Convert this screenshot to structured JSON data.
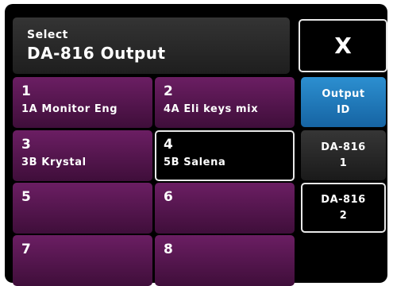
{
  "header": {
    "small_title": "Select",
    "big_title": "DA-816 Output",
    "close_label": "X"
  },
  "tiles": [
    {
      "number": "1",
      "label": "1A Monitor Eng",
      "selected": false
    },
    {
      "number": "2",
      "label": "4A Eli keys mix",
      "selected": false
    },
    {
      "number": "3",
      "label": "3B Krystal",
      "selected": false
    },
    {
      "number": "4",
      "label": "5B Salena",
      "selected": true
    },
    {
      "number": "5",
      "label": "",
      "selected": false
    },
    {
      "number": "6",
      "label": "",
      "selected": false
    },
    {
      "number": "7",
      "label": "",
      "selected": false
    },
    {
      "number": "8",
      "label": "",
      "selected": false
    }
  ],
  "side_buttons": [
    {
      "line1": "Output",
      "line2": "ID",
      "state": "active"
    },
    {
      "line1": "DA-816",
      "line2": "1",
      "state": "normal"
    },
    {
      "line1": "DA-816",
      "line2": "2",
      "state": "outlined"
    }
  ],
  "colors": {
    "tile_purple": "#5a1852",
    "active_blue": "#1f7dc0",
    "background": "#000000"
  }
}
